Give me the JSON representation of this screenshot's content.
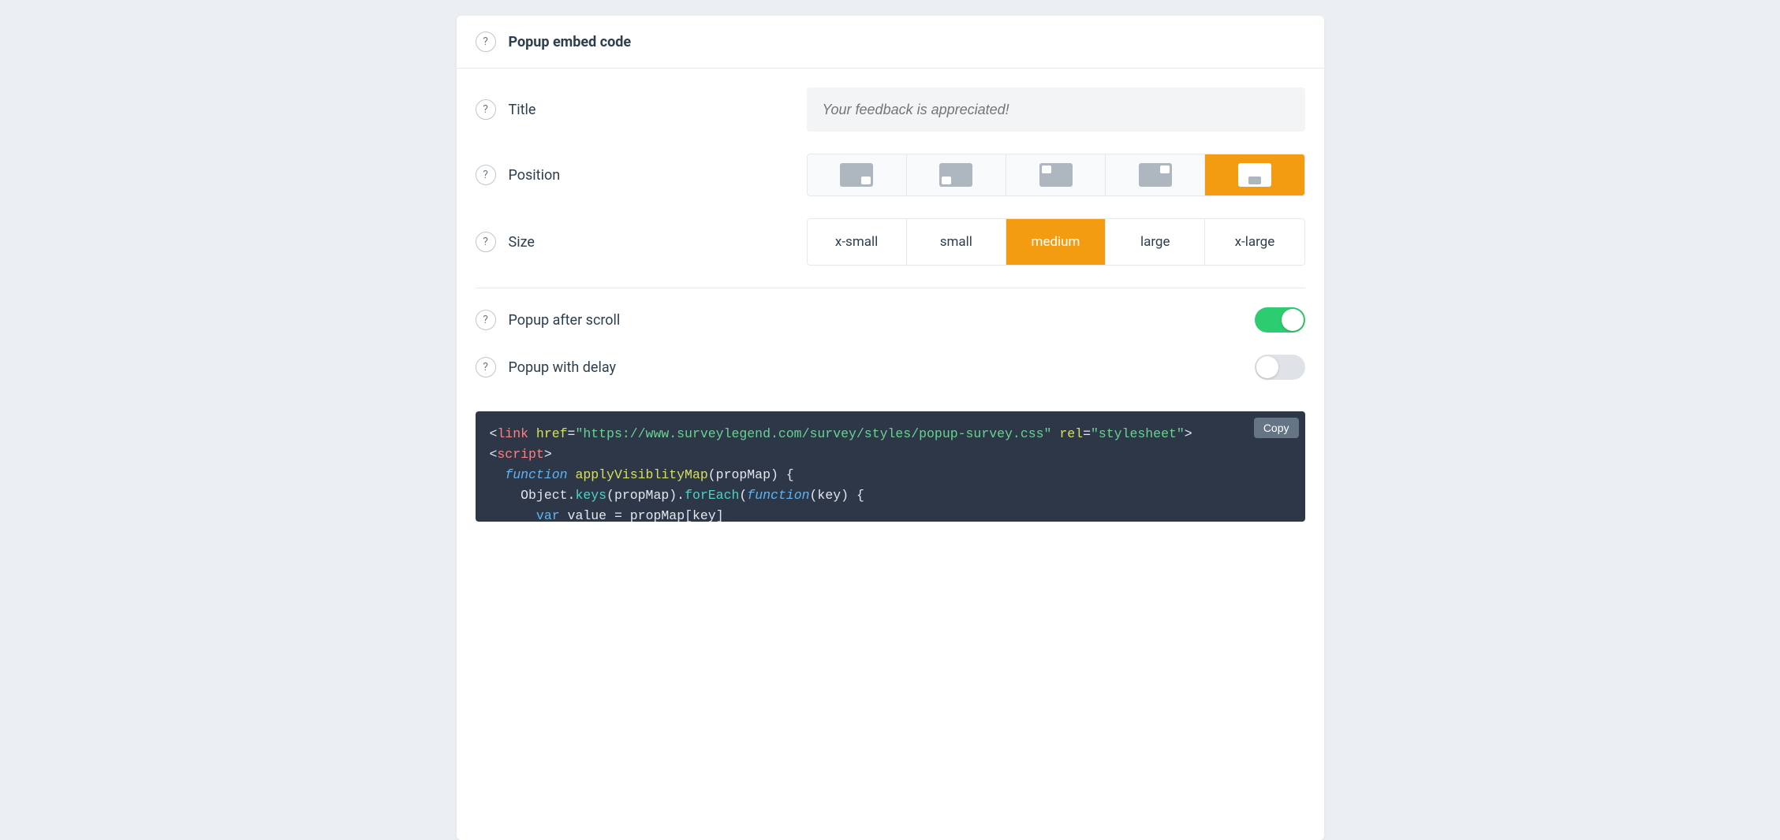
{
  "header": {
    "title": "Popup embed code"
  },
  "fields": {
    "title": {
      "label": "Title",
      "placeholder": "Your feedback is appreciated!"
    },
    "position": {
      "label": "Position",
      "options": [
        "bottom-right",
        "bottom-left",
        "top-left",
        "top-right",
        "bottom-center"
      ],
      "selected": "bottom-center"
    },
    "size": {
      "label": "Size",
      "options": [
        "x-small",
        "small",
        "medium",
        "large",
        "x-large"
      ],
      "selected": "medium"
    },
    "popup_after_scroll": {
      "label": "Popup after scroll",
      "value": true
    },
    "popup_with_delay": {
      "label": "Popup with delay",
      "value": false
    }
  },
  "code": {
    "copy_label": "Copy",
    "tokens": {
      "link": "link",
      "href": "href",
      "href_val": "\"https://www.surveylegend.com/survey/styles/popup-survey.css\"",
      "rel": "rel",
      "rel_val": "\"stylesheet\"",
      "script": "script",
      "kw_function": "function",
      "fn_apply": "applyVisiblityMap",
      "param": "propMap",
      "obj": "Object",
      "keys": "keys",
      "foreach": "forEach",
      "key": "key",
      "kw_var": "var",
      "val": "value",
      "eq": " = ",
      "bracket_expr_l": "propMap[",
      "bracket_expr_r": "key]"
    }
  },
  "colors": {
    "accent": "#f39c12",
    "toggle_on": "#2ecc71"
  }
}
